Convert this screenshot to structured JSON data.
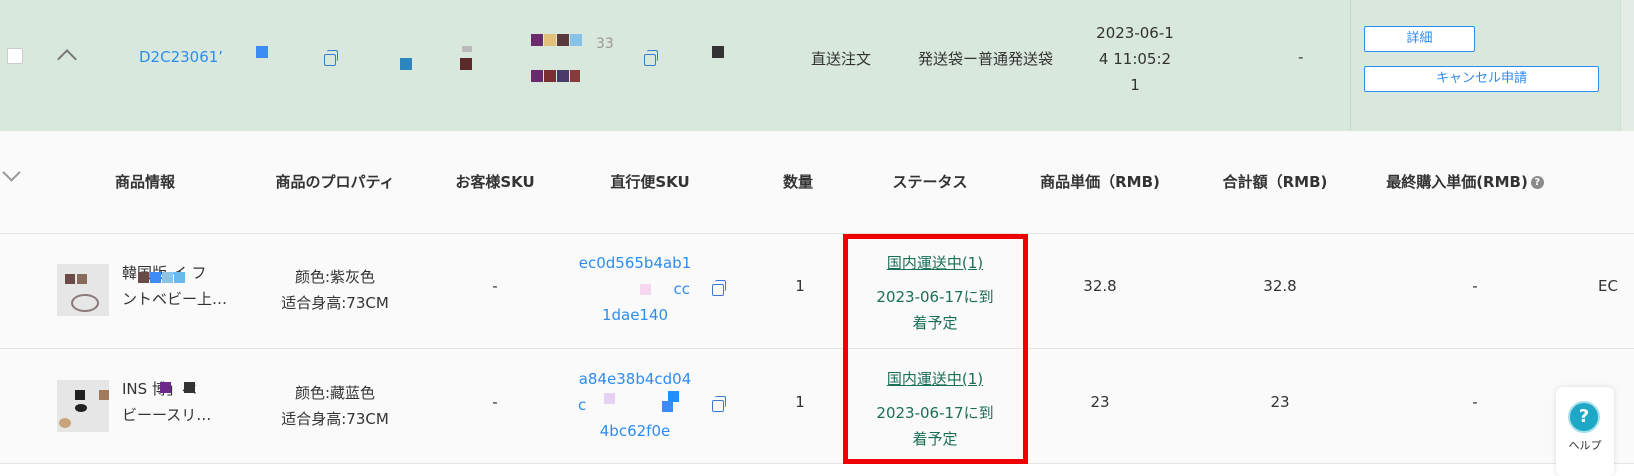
{
  "order": {
    "order_id": "D2C23061’",
    "shop_suffix": "33",
    "order_type": "直送注文",
    "shipping_method": "発送袋ー普通発送袋",
    "datetime_line1": "2023-06-1",
    "datetime_line2": "4 11:05:2",
    "datetime_line3": "1",
    "extra_value": "-",
    "detail_button": "詳細",
    "cancel_button": "キャンセル申請"
  },
  "columns": {
    "product_info": "商品情報",
    "product_property": "商品のプロパティ",
    "customer_sku": "お客様SKU",
    "direct_sku": "直行便SKU",
    "quantity": "数量",
    "status": "ステータス",
    "unit_price": "商品単価（RMB)",
    "total": "合計額（RMB)",
    "last_purchase_price": "最終購入単価(RMB)"
  },
  "products": [
    {
      "name_line1": "韓国版 イ フ",
      "name_line2": "ントベビー上…",
      "property_color": "颜色:紫灰色",
      "property_height": "适合身高:73CM",
      "customer_sku": "-",
      "sku_line1": "ec0d565b4ab1",
      "sku_line2": "cc",
      "sku_line3": "1dae140",
      "quantity": "1",
      "status_link": "国内運送中(1)",
      "status_line1": "2023-06-17に到",
      "status_line2": "着予定",
      "unit_price": "32.8",
      "total": "32.8",
      "last_price": "-",
      "overflow": "EC"
    },
    {
      "name_line1": "INS 博」ベ",
      "name_line2": "ビーースリ…",
      "property_color": "颜色:藏蓝色",
      "property_height": "适合身高:73CM",
      "customer_sku": "-",
      "sku_line1": "a84e38b4cd04",
      "sku_line2": "c",
      "sku_line3": "4bc62f0e",
      "quantity": "1",
      "status_link": "国内運送中(1)",
      "status_line1": "2023-06-17に到",
      "status_line2": "着予定",
      "unit_price": "23",
      "total": "23",
      "last_price": "-"
    }
  ],
  "help": {
    "label": "ヘルプ",
    "glyph": "?"
  },
  "colors": {
    "accent": "#2d8cf0",
    "order_row_bg": "#d9e8dc",
    "status_green": "#1a6f56",
    "highlight": "#ee0000"
  }
}
